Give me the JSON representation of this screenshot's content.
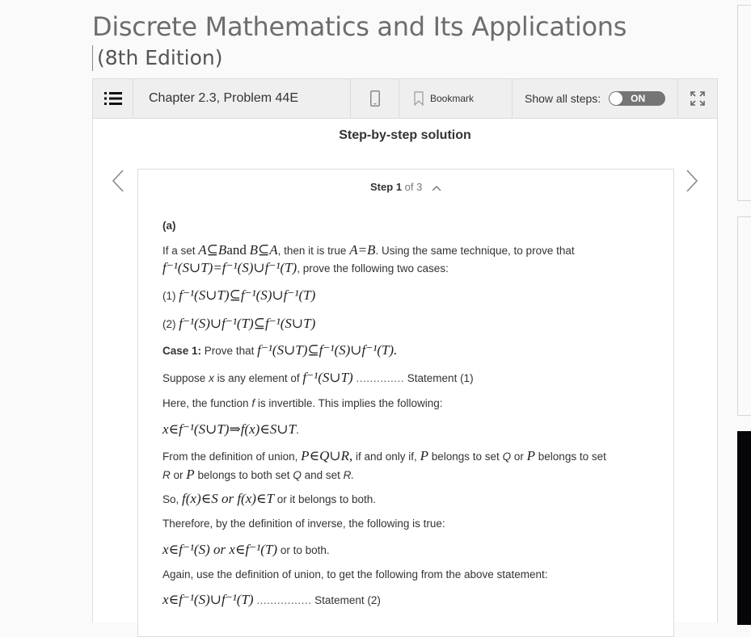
{
  "book": {
    "title": "Discrete Mathematics and Its Applications",
    "edition": "(8th Edition)"
  },
  "toolbar": {
    "menu_icon": "list-icon",
    "chapter_label": "Chapter 2.3, Problem 44E",
    "phone_icon": "mobile-phone-icon",
    "bookmark_icon": "bookmark-icon",
    "bookmark_label": "Bookmark",
    "show_steps_label": "Show all steps:",
    "toggle_label": "ON",
    "toggle_state": "on",
    "expand_icon": "expand-icon"
  },
  "solution": {
    "title": "Step-by-step solution",
    "prev_icon": "chevron-left-icon",
    "next_icon": "chevron-right-icon",
    "step": {
      "word": "Step",
      "current": "1",
      "of_text": "of 3",
      "collapse_icon": "chevron-up-icon"
    },
    "content": {
      "part_label": "(a)",
      "intro_1": "If a set",
      "intro_math_1": "A⊆B",
      "intro_and": "and",
      "intro_math_2": "B⊆A",
      "intro_2": ", then it is true",
      "intro_math_3": "A=B",
      "intro_3": ". Using the same technique, to prove that",
      "goal_math": "f⁻¹(S∪T)=f⁻¹(S)∪f⁻¹(T)",
      "goal_text": ", prove the following two cases:",
      "case_list": [
        {
          "num": "(1)",
          "math": "f⁻¹(S∪T)⊆f⁻¹(S)∪f⁻¹(T)"
        },
        {
          "num": "(2)",
          "math": "f⁻¹(S)∪f⁻¹(T)⊆f⁻¹(S∪T)"
        }
      ],
      "case1_label": "Case 1:",
      "case1_text": "Prove that",
      "case1_math": "f⁻¹(S∪T)⊆f⁻¹(S)∪f⁻¹(T).",
      "suppose_a": "Suppose",
      "suppose_x": "x",
      "suppose_b": "is any element of",
      "suppose_math": "f⁻¹(S∪T)",
      "statement1_dots": "..............",
      "statement1": "Statement (1)",
      "here_a": "Here, the function",
      "here_f": "f",
      "here_b": "is invertible. This implies the following:",
      "implies_math": "x∈f⁻¹(S∪T)⇒f(x)∈S∪T",
      "implies_end": ".",
      "union_a": "From the definition of union,",
      "union_math": "P∈Q∪R,",
      "union_b": "if and only if,",
      "union_p1": "P",
      "union_c": "belongs to set",
      "union_q": "Q",
      "union_or": "or",
      "union_p2": "P",
      "union_d": "belongs to set",
      "union2_r": "R",
      "union2_or": "or",
      "union2_p": "P",
      "union2_a": "belongs to both set",
      "union2_q": "Q",
      "union2_b": "and set",
      "union2_r2": "R.",
      "so_a": "So,",
      "so_math": "f(x)∈S or f(x)∈T",
      "so_b": "or it belongs to both.",
      "therefore": "Therefore, by the definition of inverse, the following is true:",
      "inverse_math": "x∈f⁻¹(S) or x∈f⁻¹(T)",
      "inverse_b": "or to both.",
      "again": "Again, use the definition of union, to get the following from the above statement:",
      "final_math": "x∈f⁻¹(S)∪f⁻¹(T)",
      "statement2_dots": "................",
      "statement2": "Statement (2)"
    }
  }
}
